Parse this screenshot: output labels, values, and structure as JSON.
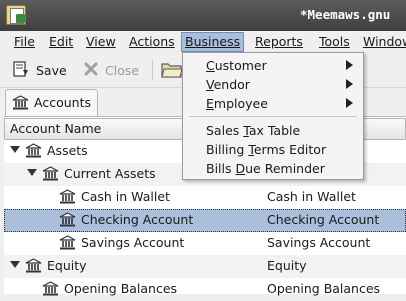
{
  "window": {
    "title": "*Meemaws.gnu"
  },
  "menubar": {
    "items": [
      {
        "label": "File",
        "mnemonic_index": 0
      },
      {
        "label": "Edit",
        "mnemonic_index": 0
      },
      {
        "label": "View",
        "mnemonic_index": 0
      },
      {
        "label": "Actions",
        "mnemonic_index": 0
      },
      {
        "label": "Business",
        "mnemonic_index": 0,
        "open": true
      },
      {
        "label": "Reports",
        "mnemonic_index": 0
      },
      {
        "label": "Tools",
        "mnemonic_index": 0
      },
      {
        "label": "Window",
        "mnemonic_index": 0
      }
    ]
  },
  "toolbar": {
    "save_label": "Save",
    "close_label": "Close",
    "save_icon": "save-icon",
    "close_icon": "close-icon",
    "open_icon": "open-folder-icon"
  },
  "tabs": [
    {
      "label": "Accounts",
      "icon": "bank-icon"
    }
  ],
  "tree": {
    "column_header": "Account Name",
    "rows": [
      {
        "name": "Assets",
        "col2": "",
        "level": 0,
        "expandable": true
      },
      {
        "name": "Current Assets",
        "col2": "Current Assets",
        "level": 1,
        "expandable": true
      },
      {
        "name": "Cash in Wallet",
        "col2": "Cash in Wallet",
        "level": 2,
        "expandable": false
      },
      {
        "name": "Checking Account",
        "col2": "Checking Account",
        "level": 2,
        "expandable": false,
        "selected": true
      },
      {
        "name": "Savings Account",
        "col2": "Savings Account",
        "level": 2,
        "expandable": false
      },
      {
        "name": "Equity",
        "col2": "Equity",
        "level": 0,
        "expandable": true
      },
      {
        "name": "Opening Balances",
        "col2": "Opening Balances",
        "level": 1,
        "expandable": false
      }
    ]
  },
  "business_menu": {
    "items": [
      {
        "label": "Customer",
        "mnemonic_index": 0,
        "submenu": true
      },
      {
        "label": "Vendor",
        "mnemonic_index": 0,
        "submenu": true
      },
      {
        "label": "Employee",
        "mnemonic_index": 0,
        "submenu": true
      },
      {
        "label": "Sales Tax Table",
        "mnemonic_index": 6,
        "submenu": false
      },
      {
        "label": "Billing Terms Editor",
        "mnemonic_index": 8,
        "submenu": false
      },
      {
        "label": "Bills Due Reminder",
        "mnemonic_index": 6,
        "submenu": false
      }
    ]
  },
  "colors": {
    "selection": "#a9bfdc",
    "menu_open": "#a7bfdb",
    "titlebar": "#4a4a4a"
  }
}
